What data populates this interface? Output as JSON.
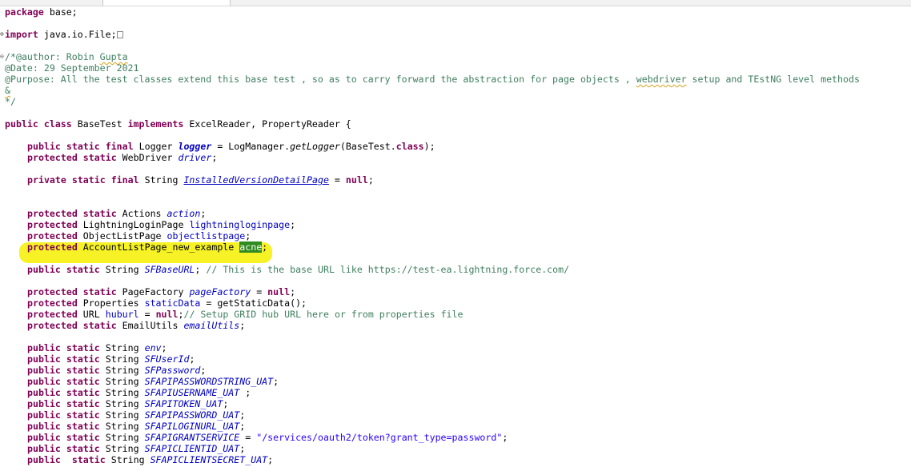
{
  "code": {
    "package_kw": "package",
    "package_name": " base;",
    "import_kw": "import",
    "import_name": " java.io.File;",
    "comment_open": "/*@author: ",
    "author_first": "Robin ",
    "author_last": "Gupta",
    "date_line": "@Date: 29 September 2021",
    "purpose_a": "@Purpose: All the test classes extend this base test , so as to carry forward the abstraction for page objects , ",
    "purpose_webdriver": "webdriver",
    "purpose_b": " setup and TEstNG level methods",
    "comment_amp": "&",
    "comment_close": "*/",
    "class_decl": {
      "kw1": "public class",
      "name": " BaseTest ",
      "kw2": "implements",
      "rest": " ExcelReader, PropertyReader {"
    },
    "logger": {
      "kw": "public static final",
      "t": " Logger ",
      "f": "logger",
      "r1": " = LogManager.",
      "m": "getLogger",
      "r2": "(BaseTest.",
      "kw2": "class",
      "r3": ");"
    },
    "driver": {
      "kw": "protected static",
      "t": " WebDriver ",
      "f": "driver",
      "r": ";"
    },
    "installed": {
      "kw": "private static final",
      "t": " String ",
      "f": "InstalledVersionDetailPage",
      "r1": " = ",
      "kw2": "null",
      "r2": ";"
    },
    "action": {
      "kw": "protected static",
      "t": " Actions ",
      "f": "action",
      "r": ";"
    },
    "lightning": {
      "kw": "protected",
      "t": " LightningLoginPage ",
      "f": "lightningloginpage",
      "r": ";"
    },
    "objectlist": {
      "kw": "protected",
      "t": " ObjectListPage ",
      "f": "objectlistpage",
      "r": ";"
    },
    "accountlist": {
      "kw": "protected",
      "t": " AccountListPage_new_example ",
      "f": "acne",
      "r": ";"
    },
    "sfbaseurl": {
      "kw": "public static",
      "t": " String ",
      "f": "SFBaseURL",
      "r": "; ",
      "c": "// This is the base URL like https://test-ea.lightning.force.com/"
    },
    "pagefactory": {
      "kw": "protected static",
      "t": " PageFactory ",
      "f": "pageFactory",
      "r1": " = ",
      "kw2": "null",
      "r2": ";"
    },
    "staticdata": {
      "kw": "protected",
      "t": " Properties ",
      "f": "staticData",
      "r": " = getStaticData();"
    },
    "huburl": {
      "kw": "protected",
      "t": " URL ",
      "f": "huburl",
      "r1": " = ",
      "kw2": "null",
      "r2": ";",
      "c": "// Setup GRID hub URL here or from properties file"
    },
    "emailutils": {
      "kw": "protected static",
      "t": " EmailUtils ",
      "f": "emailUtils",
      "r": ";"
    },
    "string_fields": [
      {
        "kw": "public static",
        "t": " String ",
        "f": "env",
        "r": ";"
      },
      {
        "kw": "public static",
        "t": " String ",
        "f": "SFUserId",
        "r": ";"
      },
      {
        "kw": "public static",
        "t": " String ",
        "f": "SFPassword",
        "r": ";"
      },
      {
        "kw": "public static",
        "t": " String ",
        "f": "SFAPIPASSWORDSTRING_UAT",
        "r": ";"
      },
      {
        "kw": "public static",
        "t": " String ",
        "f": "SFAPIUSERNAME_UAT",
        "r": " ;"
      },
      {
        "kw": "public static",
        "t": " String ",
        "f": "SFAPITOKEN_UAT",
        "r": ";"
      },
      {
        "kw": "public static",
        "t": " String ",
        "f": "SFAPIPASSWORD_UAT",
        "r": ";"
      },
      {
        "kw": "public static",
        "t": " String ",
        "f": "SFAPILOGINURL_UAT",
        "r": ";"
      },
      {
        "kw": "public static",
        "t": " String ",
        "f": "SFAPIGRANTSERVICE",
        "r": " = ",
        "s": "\"/services/oauth2/token?grant_type=password\"",
        "r2": ";"
      },
      {
        "kw": "public static",
        "t": " String ",
        "f": "SFAPICLIENTID_UAT",
        "r": ";"
      },
      {
        "kw": "public  static",
        "t": " String ",
        "f": "SFAPICLIENTSECRET_UAT",
        "r": ";"
      }
    ]
  },
  "highlight_color": "#f5f000",
  "selection_color": "#2e8b1f",
  "keyword_color": "#7f0055",
  "comment_color": "#3f7f5f",
  "field_color": "#0000c0",
  "string_color": "#2a00ff"
}
